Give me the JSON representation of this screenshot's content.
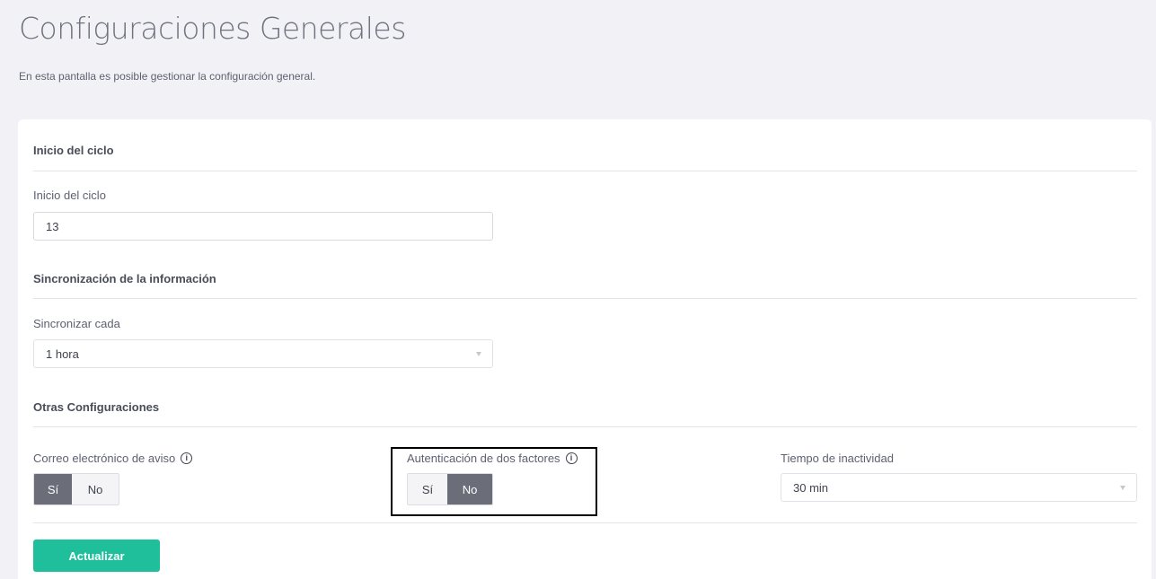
{
  "page": {
    "title": "Configuraciones Generales",
    "subtitle": "En esta pantalla es posible gestionar la configuración general."
  },
  "sections": {
    "cycle": {
      "title": "Inicio del ciclo",
      "field_label": "Inicio del ciclo",
      "field_value": "13"
    },
    "sync": {
      "title": "Sincronización de la información",
      "field_label": "Sincronizar cada",
      "selected": "1 hora"
    },
    "other": {
      "title": "Otras Configuraciones",
      "email_alert": {
        "label": "Correo electrónico de aviso",
        "options": [
          "Sí",
          "No"
        ],
        "selected": "Sí"
      },
      "two_factor": {
        "label": "Autenticación de dos factores",
        "options": [
          "Sí",
          "No"
        ],
        "selected": "No"
      },
      "inactivity": {
        "label": "Tiempo de inactividad",
        "selected": "30 min"
      }
    }
  },
  "actions": {
    "update_label": "Actualizar"
  },
  "icons": {
    "info": "info-icon",
    "dropdown": "chevron-down-icon"
  },
  "colors": {
    "accent": "#1fbf9c",
    "toggle_active": "#6b6d78",
    "background": "#f2f2f6"
  }
}
